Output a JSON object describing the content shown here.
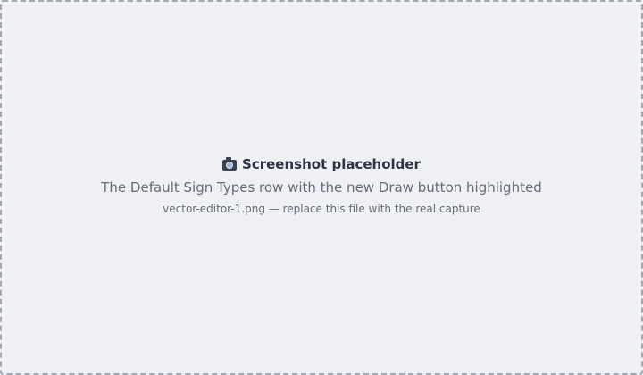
{
  "placeholder": {
    "icon": "camera-icon",
    "title": "Screenshot placeholder",
    "description": "The Default Sign Types row with the new Draw button highlighted",
    "caption": "vector-editor-1.png — replace this file with the real capture"
  },
  "colors": {
    "background": "#eff0f3",
    "border": "#a3a7b3",
    "title": "#2d3444",
    "text": "#656b78"
  }
}
